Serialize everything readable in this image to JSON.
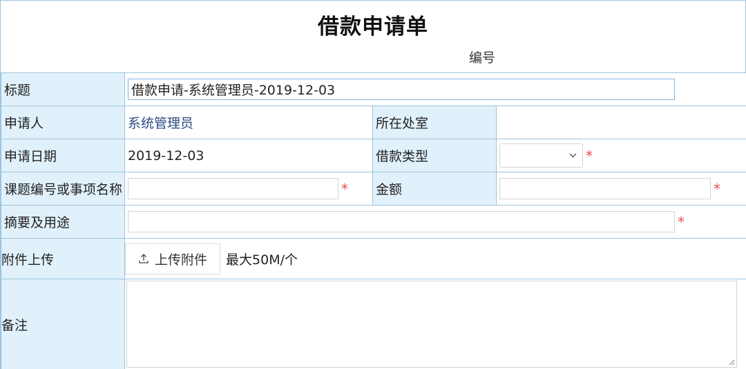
{
  "form": {
    "title": "借款申请单",
    "serial_label": "编号"
  },
  "fields": {
    "subject": {
      "label": "标题",
      "value": "借款申请-系统管理员-2019-12-03"
    },
    "applicant": {
      "label": "申请人",
      "value": "系统管理员"
    },
    "department": {
      "label": "所在处室",
      "value": ""
    },
    "apply_date": {
      "label": "申请日期",
      "value": "2019-12-03"
    },
    "loan_type": {
      "label": "借款类型",
      "value": ""
    },
    "project": {
      "label": "课题编号或事项名称",
      "value": ""
    },
    "amount": {
      "label": "金额",
      "value": ""
    },
    "summary": {
      "label": "摘要及用途",
      "value": ""
    },
    "attachment": {
      "label": "附件上传",
      "button_label": "上传附件",
      "hint": "最大50M/个"
    },
    "remarks": {
      "label": "备注",
      "value": ""
    }
  },
  "required_mark": "*",
  "icons": {
    "select_arrow": "chevron-down-icon",
    "upload": "upload-icon",
    "resize": "resize-handle-icon"
  },
  "colors": {
    "label_bg": "#e1f1fb",
    "border": "#9cc3de",
    "required": "#e5544b",
    "link": "#2a4a86"
  }
}
